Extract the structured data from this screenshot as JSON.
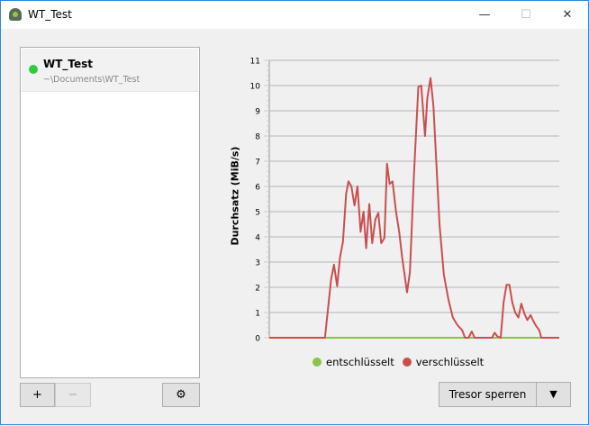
{
  "window": {
    "title": "WT_Test",
    "minimize": "—",
    "maximize": "☐",
    "close": "✕"
  },
  "vaults": [
    {
      "name": "WT_Test",
      "path": "~\\Documents\\WT_Test",
      "status_color": "#2ecc40"
    }
  ],
  "toolbar": {
    "add": "+",
    "remove": "−",
    "settings": "⚙"
  },
  "actions": {
    "lock": "Tresor sperren",
    "dropdown": "▼"
  },
  "chart_data": {
    "type": "line",
    "ylabel": "Durchsatz (MiB/s)",
    "ylim": [
      0,
      11
    ],
    "yticks": [
      "0",
      "1",
      "2",
      "3",
      "4",
      "5",
      "6",
      "7",
      "8",
      "9",
      "10",
      "11"
    ],
    "xlim": [
      0,
      100
    ],
    "grid": true,
    "legend_position": "bottom",
    "series": [
      {
        "name": "entschlüsselt",
        "color": "#8bc34a",
        "x": [
          0,
          100
        ],
        "y": [
          0,
          0
        ]
      },
      {
        "name": "verschlüsselt",
        "color": "#c94f4f",
        "x": [
          0,
          19.2,
          21.3,
          22.3,
          23.4,
          24.4,
          25.4,
          26.5,
          27.3,
          28.3,
          29.4,
          30.4,
          31.5,
          32.5,
          33.4,
          34.5,
          35.5,
          36.6,
          37.6,
          38.6,
          39.7,
          40.6,
          41.5,
          42.5,
          43.7,
          44.8,
          45.8,
          47.5,
          48.5,
          49.9,
          51.4,
          52.4,
          53.7,
          54.5,
          55.6,
          56.6,
          58.7,
          60.2,
          61.8,
          63.3,
          64.9,
          66.5,
          67.5,
          68.7,
          69.8,
          70.8,
          76.8,
          77.7,
          78.7,
          79.8,
          80.8,
          81.8,
          82.8,
          83.8,
          84.8,
          85.9,
          86.9,
          88,
          89,
          90.1,
          91.1,
          92.1,
          93.1,
          93.8,
          100
        ],
        "y": [
          0,
          0,
          2.3,
          2.9,
          2.05,
          3.2,
          3.8,
          5.7,
          6.2,
          6.0,
          5.25,
          6.0,
          4.2,
          5.0,
          3.55,
          5.3,
          3.75,
          4.7,
          4.95,
          3.75,
          3.95,
          6.9,
          6.1,
          6.2,
          5.0,
          4.2,
          3.2,
          1.8,
          2.6,
          6.5,
          9.95,
          10.0,
          8.0,
          9.5,
          10.3,
          9.2,
          4.5,
          2.5,
          1.5,
          0.8,
          0.5,
          0.3,
          0,
          0,
          0.25,
          0,
          0,
          0.2,
          0.05,
          0,
          1.4,
          2.1,
          2.1,
          1.4,
          1.0,
          0.8,
          1.35,
          0.95,
          0.7,
          0.9,
          0.65,
          0.45,
          0.3,
          0,
          0
        ]
      }
    ]
  }
}
